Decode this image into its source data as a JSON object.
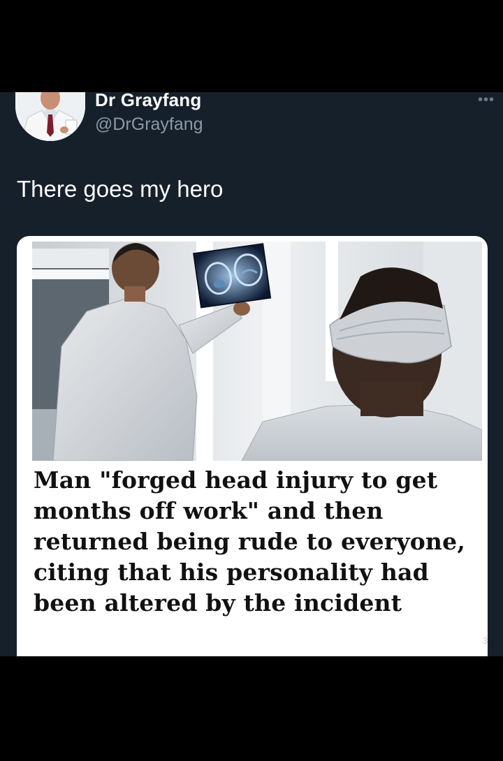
{
  "tweet": {
    "author_name": "Dr Grayfang",
    "author_handle": "@DrGrayfang",
    "more_label": "•••",
    "text": "There goes my hero"
  },
  "card": {
    "headline": "Man \"forged head injury to get months off work\" and then returned being rude to everyone, citing that his personality had been altered by the incident",
    "watermark": "3"
  },
  "colors": {
    "tweet_bg": "#15202b",
    "name": "#ffffff",
    "handle": "#8b98a5",
    "headline": "#111111"
  },
  "icons": {
    "avatar": "doctor-avatar-photo",
    "more": "more-options-icon"
  }
}
